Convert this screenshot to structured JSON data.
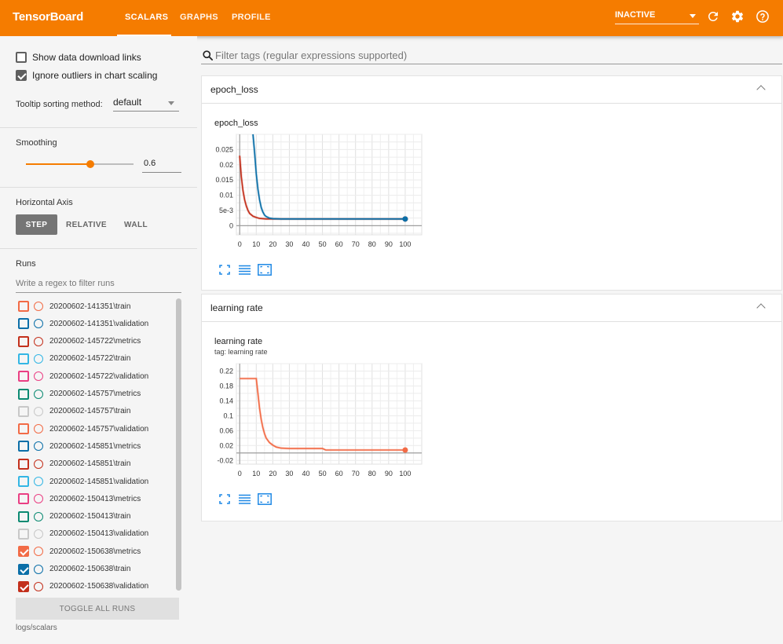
{
  "header": {
    "brand": "TensorBoard",
    "tabs": [
      "SCALARS",
      "GRAPHS",
      "PROFILE"
    ],
    "active_tab": "SCALARS",
    "run_state": "INACTIVE",
    "accent": "#f57c00"
  },
  "sidebar": {
    "show_download": "Show data download links",
    "ignore_outliers": "Ignore outliers in chart scaling",
    "show_download_checked": false,
    "ignore_outliers_checked": true,
    "tooltip_label": "Tooltip sorting method:",
    "tooltip_value": "default",
    "smoothing_label": "Smoothing",
    "smoothing_value": "0.6",
    "horizontal_axis_label": "Horizontal Axis",
    "axis_options": [
      "STEP",
      "RELATIVE",
      "WALL"
    ],
    "axis_selected": "STEP",
    "runs_label": "Runs",
    "runs_filter_placeholder": "Write a regex to filter runs",
    "runs": [
      {
        "name": "20200602-141351\\train",
        "color": "#f26b46",
        "checked": false
      },
      {
        "name": "20200602-141351\\validation",
        "color": "#0b6fa8",
        "checked": false
      },
      {
        "name": "20200602-145722\\metrics",
        "color": "#c3301c",
        "checked": false
      },
      {
        "name": "20200602-145722\\train",
        "color": "#33b6e4",
        "checked": false
      },
      {
        "name": "20200602-145722\\validation",
        "color": "#ea3f83",
        "checked": false
      },
      {
        "name": "20200602-145757\\metrics",
        "color": "#0b8a72",
        "checked": false
      },
      {
        "name": "20200602-145757\\train",
        "color": "#c8c8c8",
        "checked": false
      },
      {
        "name": "20200602-145757\\validation",
        "color": "#f26b46",
        "checked": false
      },
      {
        "name": "20200602-145851\\metrics",
        "color": "#0b6fa8",
        "checked": false
      },
      {
        "name": "20200602-145851\\train",
        "color": "#c3301c",
        "checked": false
      },
      {
        "name": "20200602-145851\\validation",
        "color": "#33b6e4",
        "checked": false
      },
      {
        "name": "20200602-150413\\metrics",
        "color": "#ea3f83",
        "checked": false
      },
      {
        "name": "20200602-150413\\train",
        "color": "#0b8a72",
        "checked": false
      },
      {
        "name": "20200602-150413\\validation",
        "color": "#c8c8c8",
        "checked": false
      },
      {
        "name": "20200602-150638\\metrics",
        "color": "#f26b46",
        "checked": true
      },
      {
        "name": "20200602-150638\\train",
        "color": "#0b6fa8",
        "checked": true
      },
      {
        "name": "20200602-150638\\validation",
        "color": "#c3301c",
        "checked": true
      }
    ],
    "toggle_all": "TOGGLE ALL RUNS",
    "logdir": "logs/scalars"
  },
  "main": {
    "filter_placeholder": "Filter tags (regular expressions supported)",
    "cards": [
      {
        "title": "epoch_loss",
        "chart_title": "epoch_loss",
        "chart_subtitle": ""
      },
      {
        "title": "learning rate",
        "chart_title": "learning rate",
        "chart_subtitle": "tag: learning rate"
      }
    ]
  },
  "chart_data": [
    {
      "type": "line",
      "title": "epoch_loss",
      "xlabel": "",
      "ylabel": "",
      "xlim": [
        -2,
        110
      ],
      "ylim": [
        -0.003,
        0.03
      ],
      "xticks": [
        0,
        10,
        20,
        30,
        40,
        50,
        60,
        70,
        80,
        90,
        100
      ],
      "yticks": [
        0,
        0.005,
        0.01,
        0.015,
        0.02,
        0.025
      ],
      "ytick_labels": [
        "0",
        "5e-3",
        "0.01",
        "0.015",
        "0.02",
        "0.025"
      ],
      "grid": true,
      "series": [
        {
          "color": "#c3301c",
          "x": [
            0,
            1,
            2,
            3,
            4,
            5,
            6,
            8,
            10,
            12,
            14,
            16,
            20,
            30,
            50,
            100
          ],
          "values": [
            0.023,
            0.016,
            0.0115,
            0.0085,
            0.0065,
            0.005,
            0.004,
            0.0031,
            0.0027,
            0.0024,
            0.0023,
            0.0022,
            0.0022,
            0.0022,
            0.0022,
            0.0022
          ]
        },
        {
          "color": "#0b6fa8",
          "x": [
            8,
            9,
            10,
            11,
            12,
            13,
            14,
            15,
            16,
            18,
            20,
            25,
            30,
            50,
            100
          ],
          "values": [
            0.03,
            0.024,
            0.017,
            0.012,
            0.0085,
            0.006,
            0.0045,
            0.0035,
            0.003,
            0.0025,
            0.0023,
            0.0022,
            0.0022,
            0.0022,
            0.0022
          ]
        }
      ]
    },
    {
      "type": "line",
      "title": "learning rate",
      "xlabel": "",
      "ylabel": "",
      "xlim": [
        -2,
        110
      ],
      "ylim": [
        -0.03,
        0.24
      ],
      "xticks": [
        0,
        10,
        20,
        30,
        40,
        50,
        60,
        70,
        80,
        90,
        100
      ],
      "yticks": [
        -0.02,
        0.02,
        0.06,
        0.1,
        0.14,
        0.18,
        0.22
      ],
      "ytick_labels": [
        "-0.02",
        "0.02",
        "0.06",
        "0.1",
        "0.14",
        "0.18",
        "0.22"
      ],
      "grid": true,
      "series": [
        {
          "color": "#f26b46",
          "x": [
            0,
            10,
            11,
            12,
            13,
            14,
            15,
            16,
            18,
            20,
            22,
            25,
            30,
            40,
            50,
            52,
            60,
            80,
            100
          ],
          "values": [
            0.2,
            0.2,
            0.16,
            0.12,
            0.09,
            0.068,
            0.052,
            0.04,
            0.028,
            0.021,
            0.016,
            0.013,
            0.012,
            0.012,
            0.012,
            0.008,
            0.008,
            0.008,
            0.008
          ]
        }
      ]
    }
  ]
}
